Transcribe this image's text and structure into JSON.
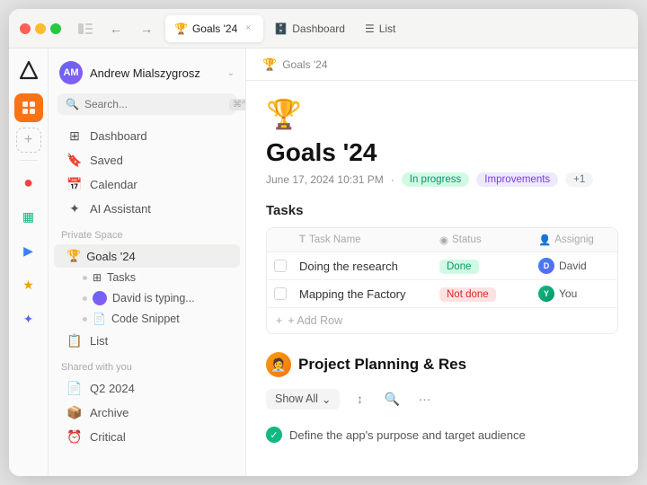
{
  "window": {
    "titlebar": {
      "back_label": "‹",
      "forward_label": "›",
      "sidebar_toggle_label": "⊞",
      "tabs": [
        {
          "id": "goals",
          "label": "Goals '24",
          "icon": "🏆",
          "active": true,
          "closable": true
        },
        {
          "id": "dashboard",
          "label": "Dashboard",
          "icon": "🗄️",
          "active": false,
          "closable": false
        },
        {
          "id": "list",
          "label": "List",
          "icon": "☰",
          "active": false,
          "closable": false
        }
      ]
    }
  },
  "rail": {
    "logo": "△",
    "items": [
      {
        "id": "active-app",
        "icon": "◈",
        "active": true
      },
      {
        "id": "add",
        "icon": "+",
        "is_add": true
      },
      {
        "id": "app2",
        "icon": "●",
        "color": "#ef4444",
        "active": false
      },
      {
        "id": "app3",
        "icon": "▦",
        "color": "#10b981",
        "active": false
      },
      {
        "id": "app4",
        "icon": "▶",
        "color": "#3b82f6",
        "active": false
      },
      {
        "id": "app5",
        "icon": "★",
        "color": "#f59e0b",
        "active": false
      },
      {
        "id": "app6",
        "icon": "✦",
        "color": "#6366f1",
        "active": false
      }
    ]
  },
  "sidebar": {
    "user_name": "Andrew Mialszygrosz",
    "user_initials": "AM",
    "search_placeholder": "Search...",
    "search_shortcut": "⌘^F",
    "nav_items": [
      {
        "id": "dashboard",
        "label": "Dashboard",
        "icon": "⊞"
      },
      {
        "id": "saved",
        "label": "Saved",
        "icon": "🔖"
      },
      {
        "id": "calendar",
        "label": "Calendar",
        "icon": "📅"
      },
      {
        "id": "ai",
        "label": "AI Assistant",
        "icon": "✦"
      }
    ],
    "private_section_label": "Private Space",
    "private_items": [
      {
        "id": "goals",
        "label": "Goals '24",
        "icon": "🏆",
        "active": true
      },
      {
        "id": "tasks",
        "label": "Tasks",
        "icon": "⊞",
        "sub": true,
        "sub_type": "dot"
      },
      {
        "id": "david",
        "label": "David is typing...",
        "sub": true,
        "sub_type": "avatar"
      },
      {
        "id": "code",
        "label": "Code Snippet",
        "icon": "📄",
        "sub": true,
        "sub_type": "dot"
      },
      {
        "id": "list",
        "label": "List",
        "icon": "📋",
        "sub": false
      }
    ],
    "shared_section_label": "Shared with you",
    "shared_items": [
      {
        "id": "q2",
        "label": "Q2 2024",
        "icon": "📄"
      },
      {
        "id": "archive",
        "label": "Archive",
        "icon": "📦"
      },
      {
        "id": "critical",
        "label": "Critical",
        "icon": "⏰"
      }
    ]
  },
  "breadcrumb": {
    "icon": "🏆",
    "label": "Goals '24"
  },
  "page": {
    "emoji": "🏆",
    "title": "Goals '24",
    "date": "June 17, 2024 10:31 PM",
    "dot": "·",
    "badges": [
      {
        "id": "progress",
        "label": "In progress",
        "type": "green"
      },
      {
        "id": "improvements",
        "label": "Improvements",
        "type": "purple"
      },
      {
        "id": "more",
        "label": "+1",
        "type": "gray"
      }
    ],
    "tasks_section": {
      "title": "Tasks",
      "columns": [
        {
          "id": "checkbox",
          "label": ""
        },
        {
          "id": "name",
          "label": "Task Name",
          "icon": "T"
        },
        {
          "id": "status",
          "label": "Status",
          "icon": "◉"
        },
        {
          "id": "assignee",
          "label": "Assignig",
          "icon": "👤"
        }
      ],
      "rows": [
        {
          "id": "row1",
          "name": "Doing the research",
          "status": "Done",
          "status_type": "done",
          "assignee_name": "David",
          "assignee_initials": "D",
          "assignee_color": "blue"
        },
        {
          "id": "row2",
          "name": "Mapping the Factory",
          "status": "Not done",
          "status_type": "notdone",
          "assignee_name": "You",
          "assignee_initials": "Y",
          "assignee_color": "green"
        }
      ],
      "add_row_label": "+ Add Row"
    },
    "project_section": {
      "emoji": "🧑‍💼",
      "title": "Project Planning & Res",
      "toolbar": {
        "show_all_label": "Show All",
        "sort_icon": "↕",
        "search_icon": "🔍",
        "more_icon": "···"
      },
      "item_text": "Define the app's purpose and target audience"
    }
  },
  "icons": {
    "chevron_down": "⌄",
    "search": "🔍",
    "sidebar_toggle": "⊞",
    "back": "←",
    "forward": "→",
    "close": "×",
    "sort": "↕",
    "more": "···",
    "check": "✓",
    "plus": "+"
  }
}
